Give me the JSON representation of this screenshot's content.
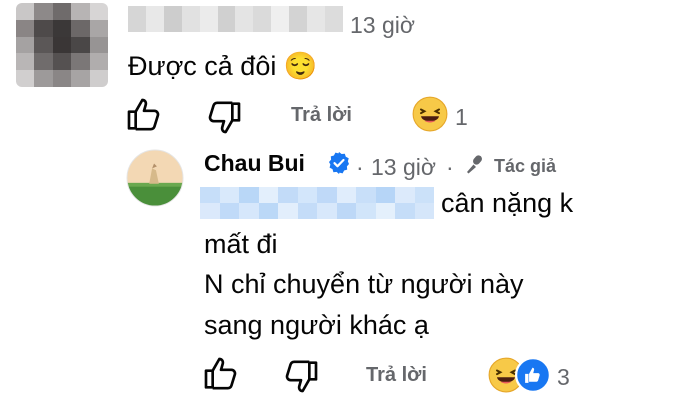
{
  "comment": {
    "time": "13 giờ",
    "text": "Được cả đôi 😌",
    "actions": {
      "like_icon": "thumb-up-outline-icon",
      "dislike_icon": "thumb-down-outline-icon",
      "reply_label": "Trả lời"
    },
    "reactions": {
      "icon": "haha-emoji-icon",
      "count": "1"
    }
  },
  "reply": {
    "author": "Chau Bui",
    "verified_icon": "verified-badge-icon",
    "time": "13 giờ",
    "role_icon": "microphone-icon",
    "role": "Tác giả",
    "line1_suffix": "cân nặng k",
    "line2": "mất đi",
    "line3": "N chỉ chuyển từ người này",
    "line4": "sang người khác ạ",
    "actions": {
      "like_icon": "thumb-up-outline-icon",
      "dislike_icon": "thumb-down-outline-icon",
      "reply_label": "Trả lời"
    },
    "reactions": {
      "icons": [
        "haha-emoji-icon",
        "like-reaction-icon"
      ],
      "count": "3"
    }
  },
  "colors": {
    "text": "#050505",
    "secondary": "#65676b",
    "verified": "#1877f2",
    "blur": "#b9d7f7"
  }
}
